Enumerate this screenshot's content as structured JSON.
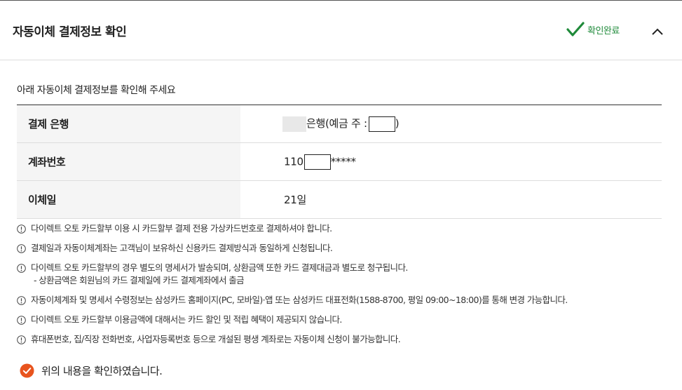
{
  "header": {
    "title": "자동이체 결제정보 확인",
    "status": "확인완료",
    "status_color": "#1f8a3a",
    "collapse_icon": "chevron-up-icon"
  },
  "intro": "아래 자동이체 결제정보를 확인해 주세요",
  "rows": [
    {
      "label": "결제 은행",
      "value_prefix": "은행(예금 주 :",
      "value_suffix": ")"
    },
    {
      "label": "계좌번호",
      "value_prefix": "110",
      "value_suffix": "*****"
    },
    {
      "label": "이체일",
      "value": "21일"
    }
  ],
  "notes": [
    "다이렉트 오토 카드할부 이용 시 카드할부 결제 전용 가상카드번호로 결제하셔야 합니다.",
    "결제일과 자동이체계좌는 고객님이 보유하신 신용카드 결제방식과 동일하게 신청됩니다.",
    "다이렉트 오토 카드할부의 경우 별도의 명세서가 발송되며, 상환금액 또한 카드 결제대금과 별도로 청구됩니다.",
    "자동이체계좌 및 명세서 수령정보는 삼성카드 홈페이지(PC, 모바일)·앱 또는 삼성카드 대표전화(1588-8700, 평일 09:00~18:00)를 통해 변경 가능합니다.",
    "다이렉트 오토 카드할부 이용금액에 대해서는 카드 할인 및 적립 혜택이 제공되지 않습니다.",
    "휴대폰번호, 집/직장 전화번호, 사업자등록번호 등으로 개설된 평생 계좌로는 자동이체 신청이 불가능합니다."
  ],
  "note_sub": "- 상환금액은 회원님의 카드 결제일에 카드 결제계좌에서 출금",
  "confirm": {
    "label": "위의 내용을 확인하였습니다.",
    "checked": true,
    "color": "#e8541e"
  }
}
